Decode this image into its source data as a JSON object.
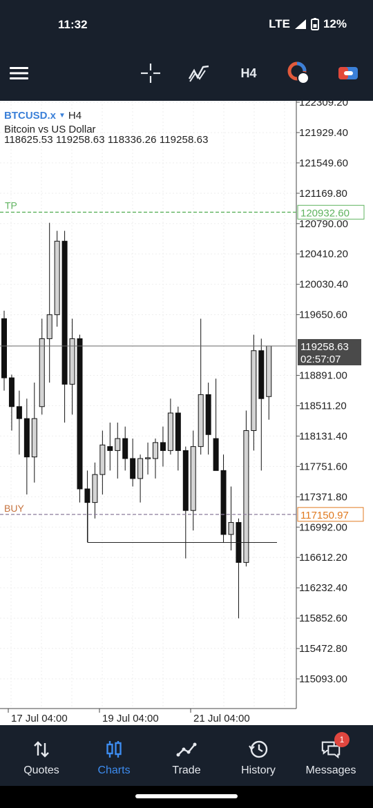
{
  "status_bar": {
    "time": "11:32",
    "network": "LTE",
    "battery": "12%"
  },
  "toolbar": {
    "timeframe": "H4"
  },
  "chart": {
    "symbol": "BTCUSD.x",
    "timeframe": "H4",
    "description": "Bitcoin vs US Dollar",
    "ohlc": "118625.53 119258.63 118336.26 119258.63",
    "tp_label": "TP",
    "tp_price": "120932.60",
    "buy_label": "BUY",
    "buy_price": "117150.97",
    "current_price": "119258.63",
    "countdown": "02:57:07",
    "colors": {
      "tp": "#5fb35f",
      "buy": "#8a7a9a",
      "buy_price": "#e07a20",
      "price_box": "#4a4a4a"
    }
  },
  "chart_data": {
    "type": "candlestick",
    "symbol": "BTCUSD.x",
    "timeframe": "H4",
    "y_ticks": [
      "122309.20",
      "121929.40",
      "121549.60",
      "121169.80",
      "120790.00",
      "120410.20",
      "120030.40",
      "119650.60",
      "118891.00",
      "118511.20",
      "118131.40",
      "117751.60",
      "117371.80",
      "116992.00",
      "116612.20",
      "116232.40",
      "115852.60",
      "115472.80",
      "115093.00"
    ],
    "x_ticks": [
      "17 Jul 04:00",
      "19 Jul 04:00",
      "21 Jul 04:00"
    ],
    "candles": [
      {
        "o": 119600,
        "h": 119700,
        "l": 118700,
        "c": 118860
      },
      {
        "o": 118860,
        "h": 118900,
        "l": 118200,
        "c": 118500
      },
      {
        "o": 118500,
        "h": 118700,
        "l": 117900,
        "c": 118350
      },
      {
        "o": 118350,
        "h": 118600,
        "l": 117400,
        "c": 117870
      },
      {
        "o": 117870,
        "h": 118800,
        "l": 117550,
        "c": 118350
      },
      {
        "o": 118500,
        "h": 119600,
        "l": 118400,
        "c": 119350
      },
      {
        "o": 119350,
        "h": 120800,
        "l": 118800,
        "c": 119650
      },
      {
        "o": 119650,
        "h": 120700,
        "l": 119500,
        "c": 120570
      },
      {
        "o": 120570,
        "h": 120700,
        "l": 118300,
        "c": 118780
      },
      {
        "o": 118780,
        "h": 119600,
        "l": 118400,
        "c": 119350
      },
      {
        "o": 119350,
        "h": 119400,
        "l": 117300,
        "c": 117470
      },
      {
        "o": 117470,
        "h": 117700,
        "l": 116800,
        "c": 117300
      },
      {
        "o": 117300,
        "h": 117800,
        "l": 117100,
        "c": 117650
      },
      {
        "o": 117650,
        "h": 118200,
        "l": 117400,
        "c": 118020
      },
      {
        "o": 118000,
        "h": 118300,
        "l": 117700,
        "c": 117950
      },
      {
        "o": 117950,
        "h": 118300,
        "l": 117600,
        "c": 118100
      },
      {
        "o": 118100,
        "h": 118250,
        "l": 117700,
        "c": 117850
      },
      {
        "o": 117850,
        "h": 118100,
        "l": 117500,
        "c": 117600
      },
      {
        "o": 117600,
        "h": 117900,
        "l": 117300,
        "c": 117850
      },
      {
        "o": 117850,
        "h": 118050,
        "l": 117650,
        "c": 117860
      },
      {
        "o": 117850,
        "h": 118100,
        "l": 117600,
        "c": 118050
      },
      {
        "o": 118050,
        "h": 118250,
        "l": 117750,
        "c": 117950
      },
      {
        "o": 117950,
        "h": 118600,
        "l": 117900,
        "c": 118420
      },
      {
        "o": 118420,
        "h": 118500,
        "l": 117700,
        "c": 117950
      },
      {
        "o": 117950,
        "h": 118000,
        "l": 116600,
        "c": 117200
      },
      {
        "o": 117200,
        "h": 118200,
        "l": 116950,
        "c": 118000
      },
      {
        "o": 118000,
        "h": 119600,
        "l": 117900,
        "c": 118650
      },
      {
        "o": 118650,
        "h": 118800,
        "l": 117900,
        "c": 118150
      },
      {
        "o": 118100,
        "h": 118850,
        "l": 117900,
        "c": 117700
      },
      {
        "o": 117700,
        "h": 117900,
        "l": 116800,
        "c": 116900
      },
      {
        "o": 116900,
        "h": 117500,
        "l": 116700,
        "c": 117050
      },
      {
        "o": 117050,
        "h": 117100,
        "l": 115850,
        "c": 116550
      },
      {
        "o": 116550,
        "h": 118450,
        "l": 116500,
        "c": 118200
      },
      {
        "o": 118200,
        "h": 119400,
        "l": 117950,
        "c": 119200
      },
      {
        "o": 119200,
        "h": 119350,
        "l": 117700,
        "c": 118600
      },
      {
        "o": 118625.53,
        "h": 119258.63,
        "l": 118336.26,
        "c": 119258.63
      }
    ],
    "horizontal_lines": [
      {
        "label": "TP",
        "price": 120932.6
      },
      {
        "label": "BUY",
        "price": 117150.97
      },
      {
        "label": "current",
        "price": 119258.63
      }
    ],
    "trend_segment": {
      "price": 116800
    }
  },
  "bottom_nav": [
    {
      "label": "Quotes",
      "icon": "quotes-icon"
    },
    {
      "label": "Charts",
      "icon": "charts-icon",
      "active": true
    },
    {
      "label": "Trade",
      "icon": "trade-icon"
    },
    {
      "label": "History",
      "icon": "history-icon"
    },
    {
      "label": "Messages",
      "icon": "messages-icon",
      "badge": "1"
    }
  ]
}
